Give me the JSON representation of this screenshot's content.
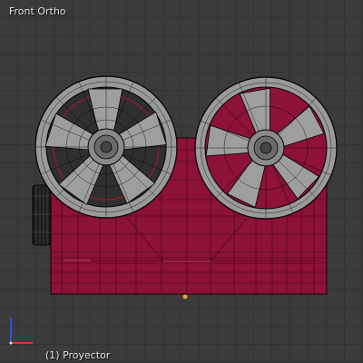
{
  "viewport": {
    "view_label": "Front Ortho",
    "object_label": "(1) Proyector",
    "object_name": "Proyector"
  },
  "colors": {
    "background": "#3b3b3b",
    "grid": "#333333",
    "body": "#8c1237",
    "body_selected_edge": "#e0507a",
    "wire": "#000000",
    "reel_face": "#8a8a8a",
    "reel_dark": "#2e2e2e",
    "axis_x": "#e03030",
    "axis_z": "#3050e0"
  },
  "icons": {
    "axis_gizmo": "axis-gizmo-icon",
    "origin": "origin-point-icon"
  }
}
